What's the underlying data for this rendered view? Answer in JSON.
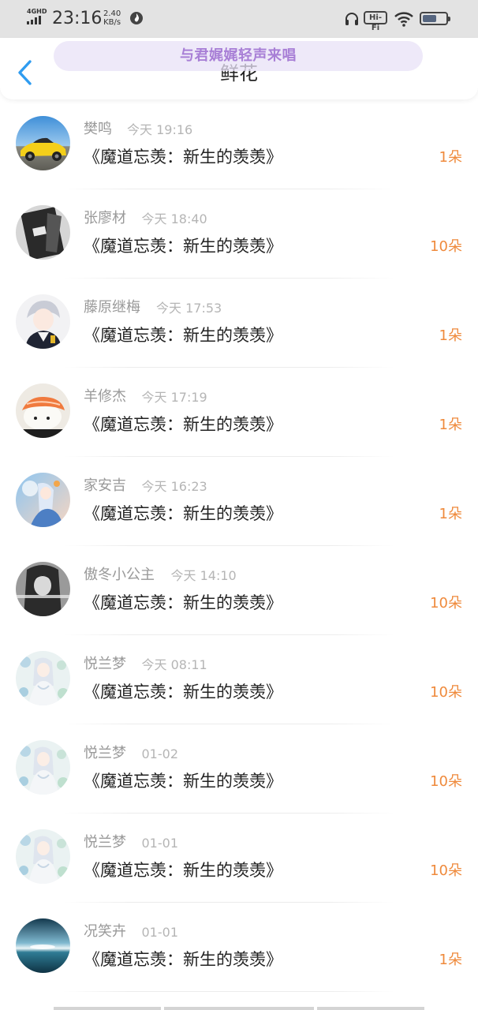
{
  "status_bar": {
    "network": "4GHD",
    "time": "23:16",
    "speed_value": "2.40",
    "speed_unit": "KB/s",
    "hifi": "Hi-Fi",
    "battery_level": 0.6
  },
  "header": {
    "title": "鲜花",
    "now_playing": "与君娓娓轻声来唱",
    "back_icon": "chevron-left-icon"
  },
  "colors": {
    "accent_blue": "#2f9cf0",
    "amount_orange": "#ef8a3c",
    "now_playing_purple": "#a87fd6"
  },
  "gifts": [
    {
      "user": "樊鸣",
      "time": "今天 19:16",
      "song": "《魔道忘羡：新生的羡羡》",
      "amount": "1朵",
      "avatar": "sports-car"
    },
    {
      "user": "张廖材",
      "time": "今天 18:40",
      "song": "《魔道忘羡：新生的羡羡》",
      "amount": "10朵",
      "avatar": "dark-portrait"
    },
    {
      "user": "藤原继梅",
      "time": "今天 17:53",
      "song": "《魔道忘羡：新生的羡羡》",
      "amount": "1朵",
      "avatar": "anime-boy"
    },
    {
      "user": "羊修杰",
      "time": "今天 17:19",
      "song": "《魔道忘羡：新生的羡羡》",
      "amount": "1朵",
      "avatar": "sushi"
    },
    {
      "user": "家安吉",
      "time": "今天 16:23",
      "song": "《魔道忘羡：新生的羡羡》",
      "amount": "1朵",
      "avatar": "anime-sky"
    },
    {
      "user": "傲冬小公主",
      "time": "今天 14:10",
      "song": "《魔道忘羡：新生的羡羡》",
      "amount": "10朵",
      "avatar": "monochrome-girl"
    },
    {
      "user": "悦兰梦",
      "time": "今天 08:11",
      "song": "《魔道忘羡：新生的羡羡》",
      "amount": "10朵",
      "avatar": "floral-anime"
    },
    {
      "user": "悦兰梦",
      "time": "01-02",
      "song": "《魔道忘羡：新生的羡羡》",
      "amount": "10朵",
      "avatar": "floral-anime"
    },
    {
      "user": "悦兰梦",
      "time": "01-01",
      "song": "《魔道忘羡：新生的羡羡》",
      "amount": "10朵",
      "avatar": "floral-anime"
    },
    {
      "user": "况笑卉",
      "time": "01-01",
      "song": "《魔道忘羡：新生的羡羡》",
      "amount": "1朵",
      "avatar": "ocean-sunset"
    }
  ]
}
